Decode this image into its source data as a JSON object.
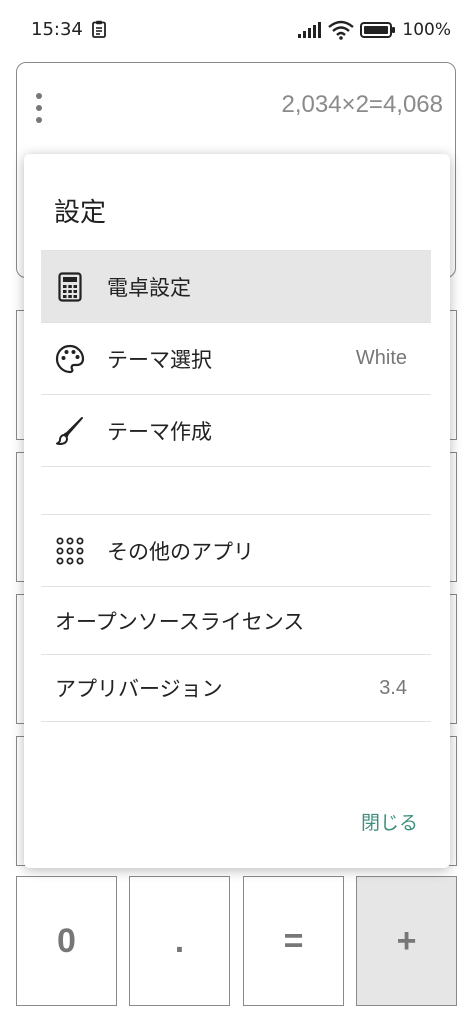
{
  "status_bar": {
    "time": "15:34",
    "battery": "100%"
  },
  "display": {
    "expression": "2,034×2=4,068"
  },
  "keypad": {
    "keys": [
      "0",
      ".",
      "=",
      "+"
    ]
  },
  "dialog": {
    "title": "設定",
    "items": [
      {
        "label": "電卓設定",
        "icon": "calculator-icon",
        "value": ""
      },
      {
        "label": "テーマ選択",
        "icon": "palette-icon",
        "value": "White"
      },
      {
        "label": "テーマ作成",
        "icon": "brush-icon",
        "value": ""
      },
      {
        "label": "その他のアプリ",
        "icon": "apps-grid-icon",
        "value": ""
      },
      {
        "label": "オープンソースライセンス",
        "icon": "",
        "value": ""
      },
      {
        "label": "アプリバージョン",
        "icon": "",
        "value": "3.4"
      }
    ],
    "close_label": "閉じる"
  },
  "colors": {
    "accent": "#3f8f7f",
    "highlight": "#e6e6e6",
    "border": "#8a8a8a"
  }
}
